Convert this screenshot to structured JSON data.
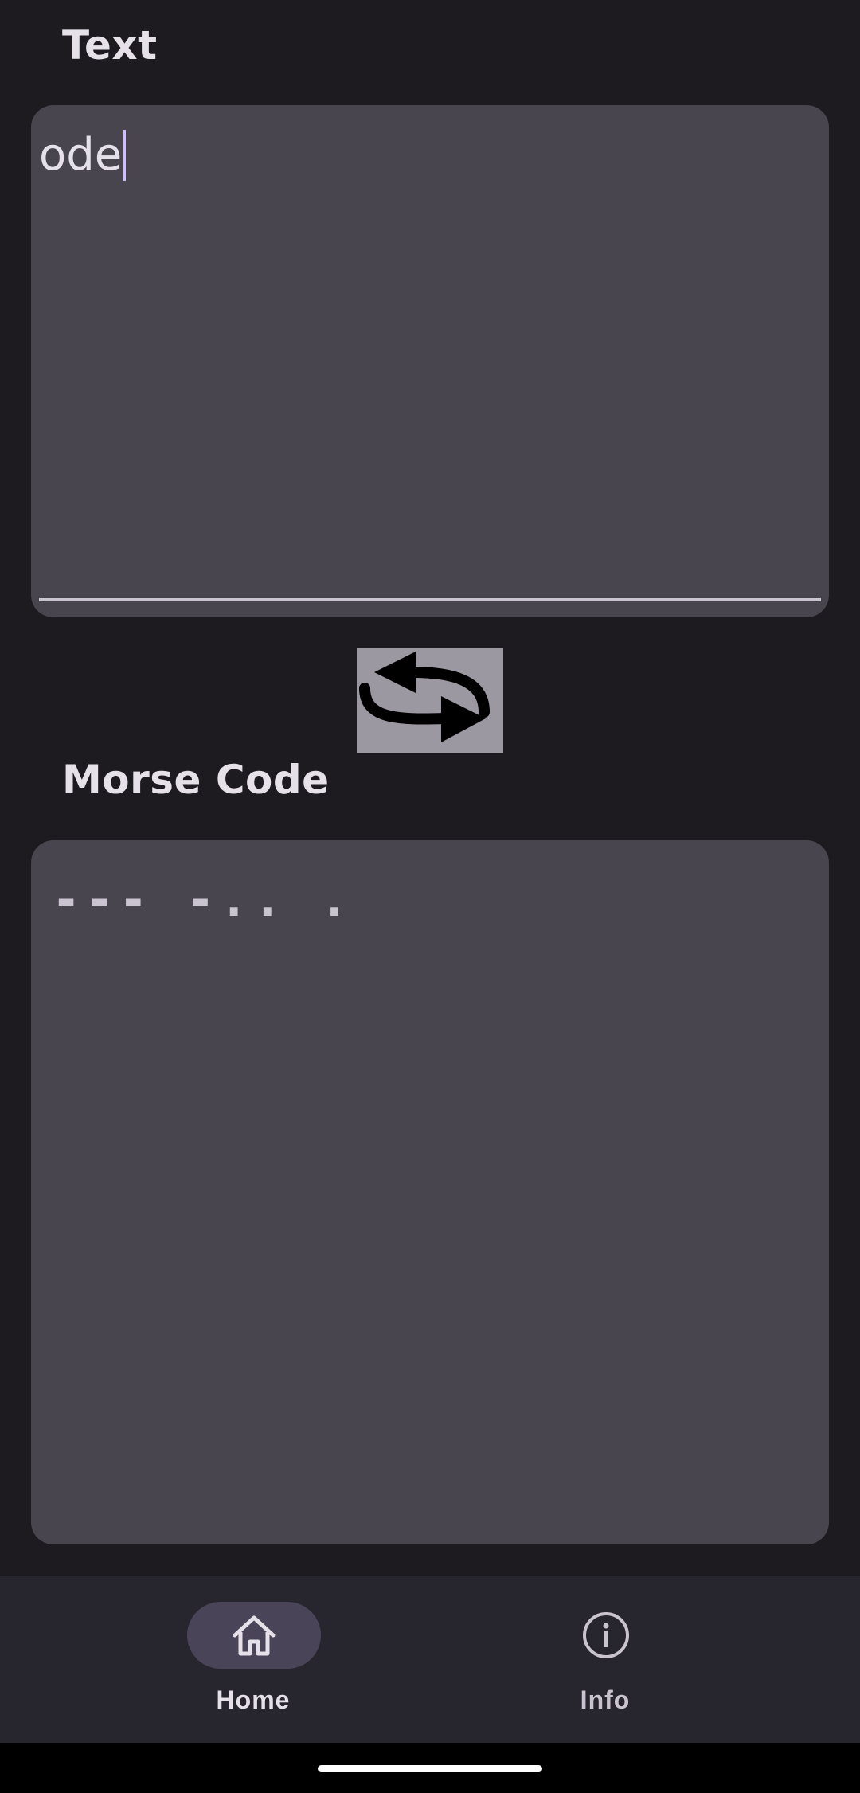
{
  "input_section": {
    "label": "Text",
    "value": "ode"
  },
  "swap_button": {
    "icon": "swap-arrows-icon"
  },
  "output_section": {
    "label": "Morse Code",
    "value": "--- -.. ."
  },
  "bottom_nav": {
    "items": [
      {
        "label": "Home",
        "icon": "home-icon",
        "selected": true
      },
      {
        "label": "Info",
        "icon": "info-icon",
        "selected": false
      }
    ]
  },
  "colors": {
    "background": "#1d1b20",
    "field_background": "#49454f",
    "nav_background": "#27252d",
    "nav_indicator": "#4a4458",
    "text": "#e6e0e9"
  }
}
